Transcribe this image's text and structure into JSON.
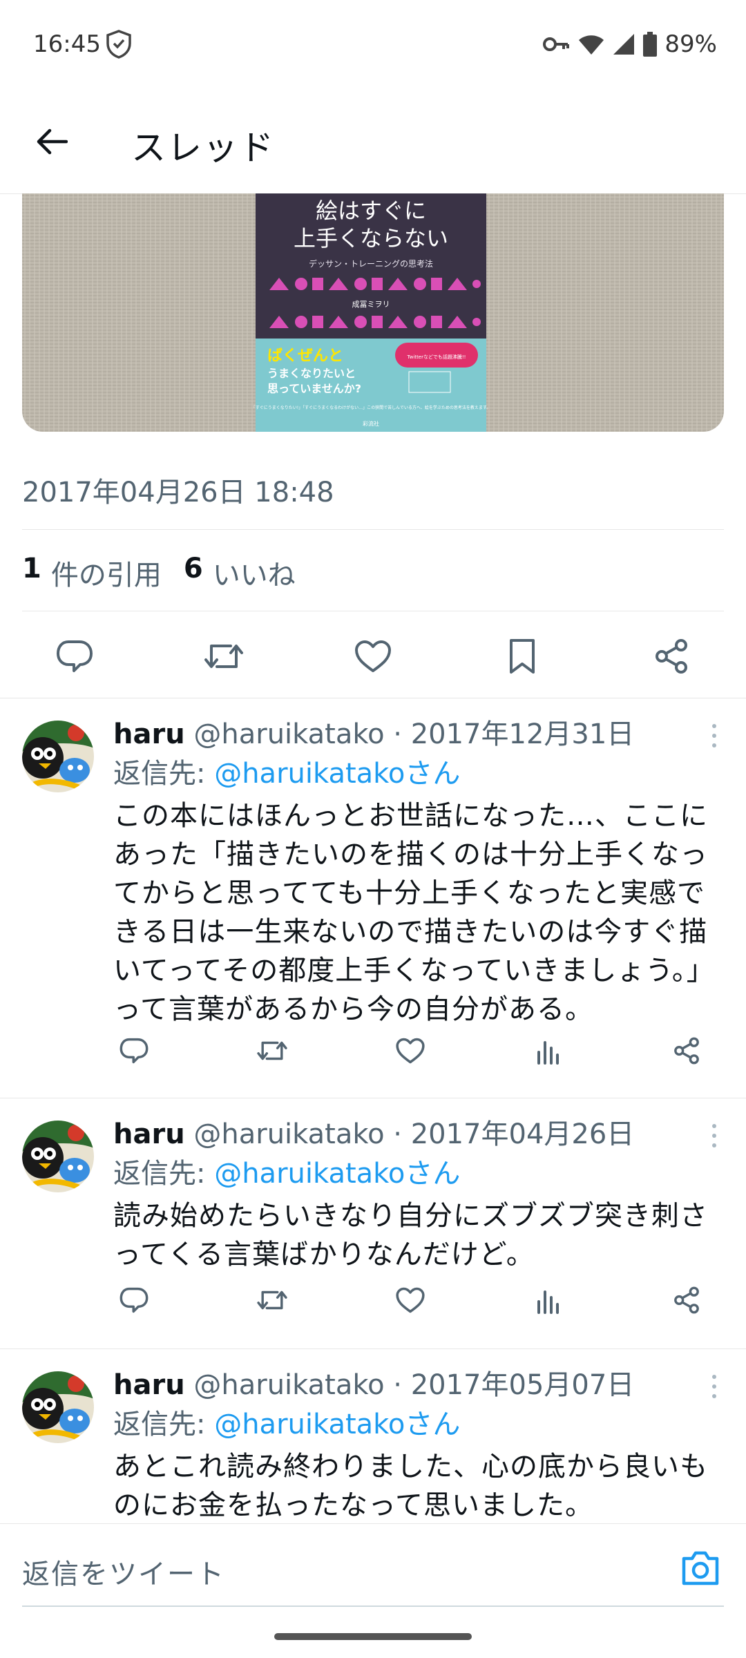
{
  "status": {
    "time": "16:45",
    "battery": "89%"
  },
  "header": {
    "title": "スレッド"
  },
  "tweet": {
    "timestamp": "2017年04月26日 18:48",
    "quote_count": "1",
    "quote_label": "件の引用",
    "like_count": "6",
    "like_label": "いいね",
    "image": {
      "title_line1": "絵はすぐに",
      "title_line2": "上手くならない",
      "subtitle": "デッサン・トレーニングの思考法",
      "author": "成冨ミヲリ",
      "band_line1": "ばくぜんと",
      "band_line2": "うまくなりたいと",
      "band_line3": "思っていませんか?",
      "badge": "Twitterなどでも話題沸騰!!",
      "small_text": "「すぐにうまくなりたい!」「すぐにうまくなるわけがない…」この狭間で苦しんでいる方へ、絵を学ぶための思考法を教えます。",
      "publisher": "彩流社"
    }
  },
  "replies": [
    {
      "name": "haru",
      "handle": "@haruikatako",
      "date": "· 2017年12月31日",
      "reply_label": "返信先:",
      "reply_to": "@haruikatakoさん",
      "text": "この本にはほんっとお世話になった…、ここにあった「描きたいのを描くのは十分上手くなってからと思ってても十分上手くなったと実感できる日は一生来ないので描きたいのは今すぐ描いてってその都度上手くなっていきましょう。」って言葉があるから今の自分がある。"
    },
    {
      "name": "haru",
      "handle": "@haruikatako",
      "date": "· 2017年04月26日",
      "reply_label": "返信先:",
      "reply_to": "@haruikatakoさん",
      "text": "読み始めたらいきなり自分にズブズブ突き刺さってくる言葉ばかりなんだけど。"
    },
    {
      "name": "haru",
      "handle": "@haruikatako",
      "date": "· 2017年05月07日",
      "reply_label": "返信先:",
      "reply_to": "@haruikatakoさん",
      "text": "あとこれ読み終わりました、心の底から良いものにお金を払ったなって思いました。"
    }
  ],
  "composer": {
    "placeholder": "返信をツイート"
  },
  "colors": {
    "accent": "#1d9bf0",
    "text_primary": "#0f1419",
    "text_secondary": "#536471",
    "divider": "#e7e7e7"
  },
  "icons": [
    "back-arrow-icon",
    "reply-icon",
    "retweet-icon",
    "like-icon",
    "bookmark-icon",
    "share-icon",
    "views-icon",
    "more-icon",
    "camera-icon",
    "shield-icon",
    "key-icon",
    "wifi-icon",
    "signal-icon",
    "battery-icon"
  ]
}
